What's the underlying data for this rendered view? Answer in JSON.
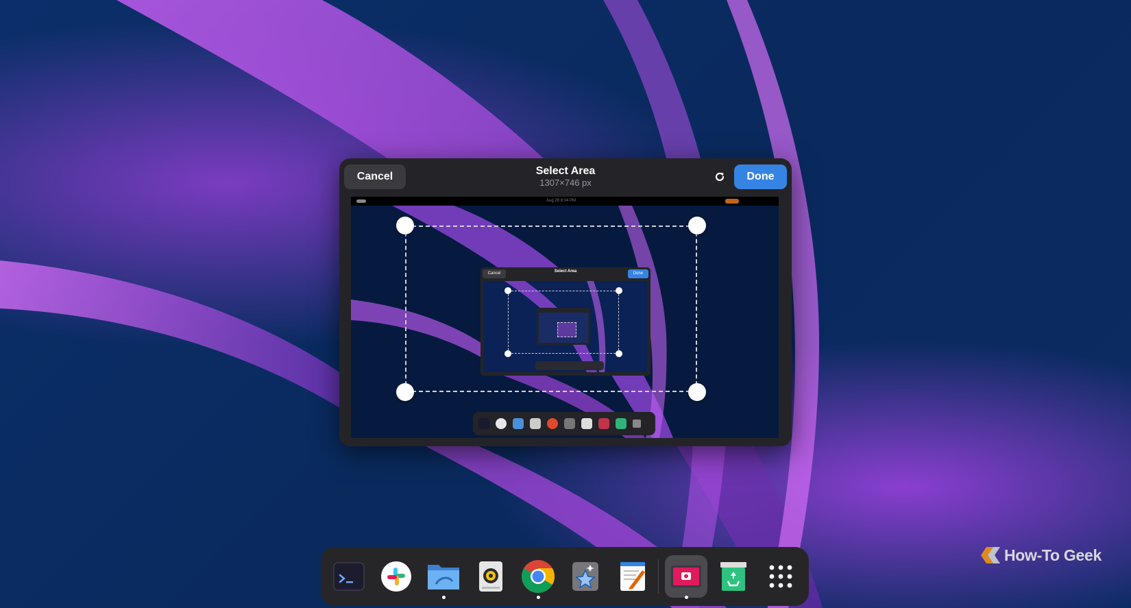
{
  "dialog": {
    "cancel_label": "Cancel",
    "title": "Select Area",
    "dimensions": "1307×746 px",
    "reset_icon": "refresh-icon",
    "done_label": "Done"
  },
  "preview": {
    "topbar_clock": "Aug 28  8:04 PM",
    "mini_cancel": "Cancel",
    "mini_title": "Select Area",
    "mini_done": "Done"
  },
  "dock": {
    "items": [
      {
        "name": "Terminal",
        "icon": "terminal-icon"
      },
      {
        "name": "Slack",
        "icon": "slack-icon"
      },
      {
        "name": "Files",
        "icon": "files-icon",
        "running": true
      },
      {
        "name": "Rhythmbox",
        "icon": "speaker-icon"
      },
      {
        "name": "Google Chrome",
        "icon": "chrome-icon",
        "running": true
      },
      {
        "name": "Celebrity",
        "icon": "star-icon"
      },
      {
        "name": "Text Editor",
        "icon": "text-editor-icon"
      },
      {
        "name": "Screenshot",
        "icon": "screenshot-icon",
        "running": true,
        "active": true
      },
      {
        "name": "Trash",
        "icon": "trash-icon"
      },
      {
        "name": "Show Applications",
        "icon": "app-grid-icon"
      }
    ]
  },
  "watermark": "How-To Geek",
  "colors": {
    "accent": "#3584e4",
    "dialog_bg": "#242428",
    "dock_bg": "#262629"
  }
}
